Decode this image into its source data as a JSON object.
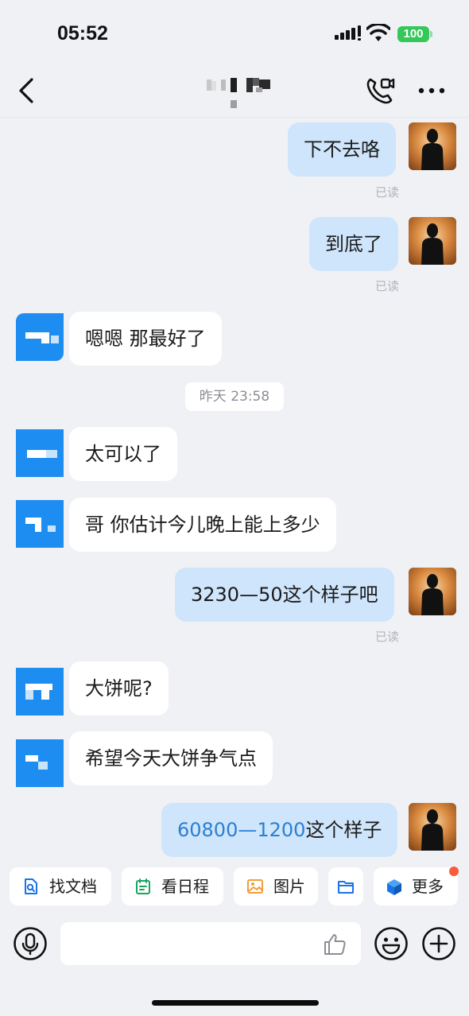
{
  "status_bar": {
    "time": "05:52",
    "battery": "100"
  },
  "header": {
    "back_icon": "chevron-left-icon",
    "call_icon": "phone-video-icon",
    "more_icon": "ellipsis-icon"
  },
  "read_label": "已读",
  "timestamp": "昨天 23:58",
  "messages": [
    {
      "side": "out",
      "text": "下不去咯",
      "read": "已读"
    },
    {
      "side": "out",
      "text": "到底了",
      "read": "已读"
    },
    {
      "side": "in",
      "text": "嗯嗯 那最好了"
    },
    {
      "side": "in",
      "text": "太可以了"
    },
    {
      "side": "in",
      "text": "哥 你估计今儿晚上能上多少"
    },
    {
      "side": "out",
      "text": "3230—50这个样子吧",
      "read": "已读"
    },
    {
      "side": "in",
      "text": "大饼呢?"
    },
    {
      "side": "in",
      "text": "希望今天大饼争气点"
    },
    {
      "side": "out",
      "text_highlight": "60800—1200",
      "text_rest": "这个样子"
    }
  ],
  "quick_actions": [
    {
      "label": "找文档",
      "icon": "doc-search-icon",
      "color": "#1a73e8"
    },
    {
      "label": "看日程",
      "icon": "calendar-icon",
      "color": "#1aa260"
    },
    {
      "label": "图片",
      "icon": "image-icon",
      "color": "#f29d38"
    },
    {
      "label": "",
      "icon": "folder-icon",
      "color": "#1a73e8"
    },
    {
      "label": "更多",
      "icon": "cube-icon",
      "color": "#1a73e8"
    }
  ],
  "input": {
    "placeholder": ""
  }
}
